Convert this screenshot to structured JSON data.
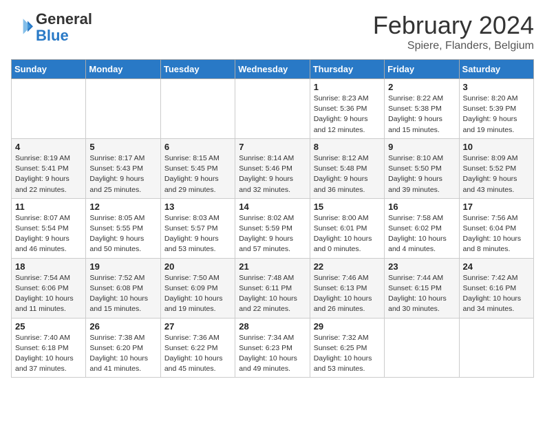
{
  "header": {
    "logo_general": "General",
    "logo_blue": "Blue",
    "month_title": "February 2024",
    "location": "Spiere, Flanders, Belgium"
  },
  "days_of_week": [
    "Sunday",
    "Monday",
    "Tuesday",
    "Wednesday",
    "Thursday",
    "Friday",
    "Saturday"
  ],
  "weeks": [
    [
      null,
      null,
      null,
      null,
      {
        "day": 1,
        "sunrise": "8:23 AM",
        "sunset": "5:36 PM",
        "daylight": "9 hours and 12 minutes."
      },
      {
        "day": 2,
        "sunrise": "8:22 AM",
        "sunset": "5:38 PM",
        "daylight": "9 hours and 15 minutes."
      },
      {
        "day": 3,
        "sunrise": "8:20 AM",
        "sunset": "5:39 PM",
        "daylight": "9 hours and 19 minutes."
      }
    ],
    [
      {
        "day": 4,
        "sunrise": "8:19 AM",
        "sunset": "5:41 PM",
        "daylight": "9 hours and 22 minutes."
      },
      {
        "day": 5,
        "sunrise": "8:17 AM",
        "sunset": "5:43 PM",
        "daylight": "9 hours and 25 minutes."
      },
      {
        "day": 6,
        "sunrise": "8:15 AM",
        "sunset": "5:45 PM",
        "daylight": "9 hours and 29 minutes."
      },
      {
        "day": 7,
        "sunrise": "8:14 AM",
        "sunset": "5:46 PM",
        "daylight": "9 hours and 32 minutes."
      },
      {
        "day": 8,
        "sunrise": "8:12 AM",
        "sunset": "5:48 PM",
        "daylight": "9 hours and 36 minutes."
      },
      {
        "day": 9,
        "sunrise": "8:10 AM",
        "sunset": "5:50 PM",
        "daylight": "9 hours and 39 minutes."
      },
      {
        "day": 10,
        "sunrise": "8:09 AM",
        "sunset": "5:52 PM",
        "daylight": "9 hours and 43 minutes."
      }
    ],
    [
      {
        "day": 11,
        "sunrise": "8:07 AM",
        "sunset": "5:54 PM",
        "daylight": "9 hours and 46 minutes."
      },
      {
        "day": 12,
        "sunrise": "8:05 AM",
        "sunset": "5:55 PM",
        "daylight": "9 hours and 50 minutes."
      },
      {
        "day": 13,
        "sunrise": "8:03 AM",
        "sunset": "5:57 PM",
        "daylight": "9 hours and 53 minutes."
      },
      {
        "day": 14,
        "sunrise": "8:02 AM",
        "sunset": "5:59 PM",
        "daylight": "9 hours and 57 minutes."
      },
      {
        "day": 15,
        "sunrise": "8:00 AM",
        "sunset": "6:01 PM",
        "daylight": "10 hours and 0 minutes."
      },
      {
        "day": 16,
        "sunrise": "7:58 AM",
        "sunset": "6:02 PM",
        "daylight": "10 hours and 4 minutes."
      },
      {
        "day": 17,
        "sunrise": "7:56 AM",
        "sunset": "6:04 PM",
        "daylight": "10 hours and 8 minutes."
      }
    ],
    [
      {
        "day": 18,
        "sunrise": "7:54 AM",
        "sunset": "6:06 PM",
        "daylight": "10 hours and 11 minutes."
      },
      {
        "day": 19,
        "sunrise": "7:52 AM",
        "sunset": "6:08 PM",
        "daylight": "10 hours and 15 minutes."
      },
      {
        "day": 20,
        "sunrise": "7:50 AM",
        "sunset": "6:09 PM",
        "daylight": "10 hours and 19 minutes."
      },
      {
        "day": 21,
        "sunrise": "7:48 AM",
        "sunset": "6:11 PM",
        "daylight": "10 hours and 22 minutes."
      },
      {
        "day": 22,
        "sunrise": "7:46 AM",
        "sunset": "6:13 PM",
        "daylight": "10 hours and 26 minutes."
      },
      {
        "day": 23,
        "sunrise": "7:44 AM",
        "sunset": "6:15 PM",
        "daylight": "10 hours and 30 minutes."
      },
      {
        "day": 24,
        "sunrise": "7:42 AM",
        "sunset": "6:16 PM",
        "daylight": "10 hours and 34 minutes."
      }
    ],
    [
      {
        "day": 25,
        "sunrise": "7:40 AM",
        "sunset": "6:18 PM",
        "daylight": "10 hours and 37 minutes."
      },
      {
        "day": 26,
        "sunrise": "7:38 AM",
        "sunset": "6:20 PM",
        "daylight": "10 hours and 41 minutes."
      },
      {
        "day": 27,
        "sunrise": "7:36 AM",
        "sunset": "6:22 PM",
        "daylight": "10 hours and 45 minutes."
      },
      {
        "day": 28,
        "sunrise": "7:34 AM",
        "sunset": "6:23 PM",
        "daylight": "10 hours and 49 minutes."
      },
      {
        "day": 29,
        "sunrise": "7:32 AM",
        "sunset": "6:25 PM",
        "daylight": "10 hours and 53 minutes."
      },
      null,
      null
    ]
  ]
}
